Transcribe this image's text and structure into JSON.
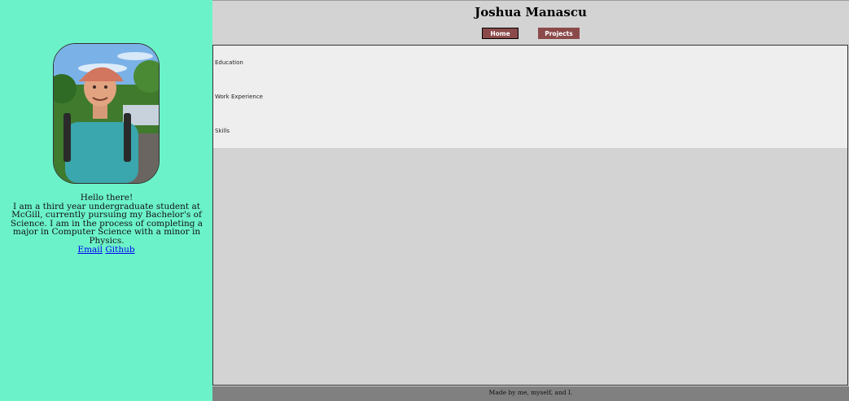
{
  "sidebar": {
    "greeting": "Hello there!",
    "bio": "I am a third year undergraduate student at McGill, currently pursuing my Bachelor's of Science. I am in the process of completing a major in Computer Science with a minor in Physics.",
    "links": {
      "email": "Email",
      "github": "Github"
    }
  },
  "header": {
    "title": "Joshua Manascu",
    "nav": {
      "home": "Home",
      "projects": "Projects"
    }
  },
  "main": {
    "sections": [
      "Education",
      "Work Experience",
      "Skills"
    ]
  },
  "footer": {
    "text": "Made by me, myself, and I."
  },
  "colors": {
    "sidebar_bg": "#6cf2c9",
    "nav_button": "#8b4a4a",
    "page_bg": "#d3d3d3",
    "sections_bg": "#eeeeee",
    "footer_bg": "#808080"
  }
}
